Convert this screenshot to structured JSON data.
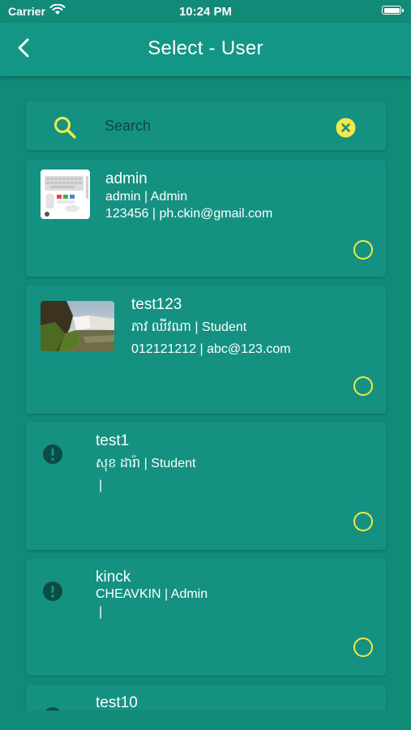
{
  "status_bar": {
    "carrier": "Carrier",
    "time": "10:24 PM"
  },
  "header": {
    "title": "Select - User",
    "back_icon": "chevron-left-icon"
  },
  "search": {
    "placeholder": "Search",
    "value": "",
    "icon": "search-icon",
    "clear_icon": "clear-circle-icon"
  },
  "colors": {
    "background": "#128a78",
    "card": "#149181",
    "accent": "#f2e94a",
    "search_text": "#0d4a41"
  },
  "users": [
    {
      "name": "admin",
      "detail": "admin | Admin",
      "contact": "123456 | ph.ckin@gmail.com",
      "avatar": "keyboard-mouse-photo",
      "selected": false
    },
    {
      "name": "test123",
      "detail": "ភាវ ឈីវណា | Student",
      "contact": "012121212 | abc@123.com",
      "avatar": "waterfall-photo",
      "selected": false
    },
    {
      "name": "test1",
      "detail": "សុខ ដារ៉ា | Student",
      "contact": "|",
      "avatar": "alert-icon",
      "selected": false
    },
    {
      "name": "kinck",
      "detail": "CHEAVKIN | Admin",
      "contact": "|",
      "avatar": "alert-icon",
      "selected": false
    },
    {
      "name": "test10",
      "detail": "",
      "contact": "",
      "avatar": "alert-icon",
      "selected": false
    }
  ]
}
